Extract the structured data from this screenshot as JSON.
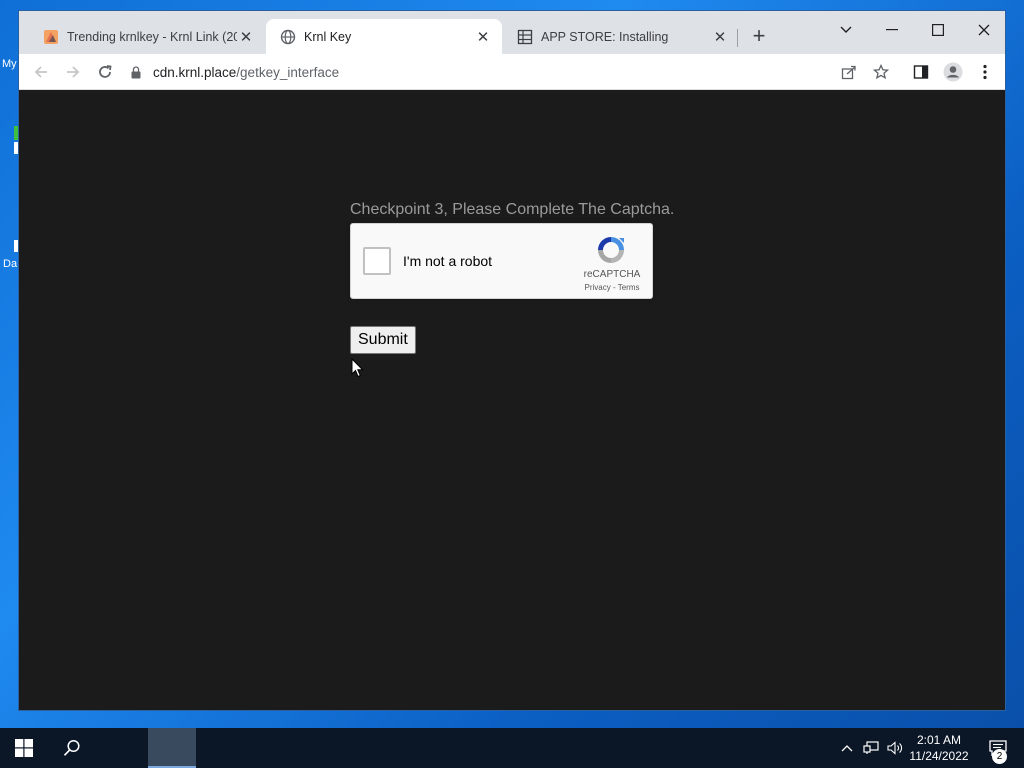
{
  "desktop": {
    "fragment_top": "My",
    "fragment_bottom": "Da"
  },
  "browser": {
    "tabs": [
      {
        "title": "Trending krnlkey - Krnl Link (202",
        "icon": "krnl-favicon",
        "active": false
      },
      {
        "title": "Krnl Key",
        "icon": "globe-icon",
        "active": true
      },
      {
        "title": "APP STORE: Installing",
        "icon": "table-icon",
        "active": false
      }
    ],
    "close_glyph": "✕",
    "new_tab_glyph": "+",
    "url_host": "cdn.krnl.place",
    "url_path": "/getkey_interface"
  },
  "page": {
    "title": "Checkpoint 3, Please Complete The Captcha.",
    "recaptcha": {
      "label": "I'm not a robot",
      "brand": "reCAPTCHA",
      "links": "Privacy - Terms"
    },
    "submit_label": "Submit"
  },
  "taskbar": {
    "time": "2:01 AM",
    "date": "11/24/2022",
    "notification_count": "2"
  },
  "colors": {
    "page_background": "#1b1b1c",
    "title_text": "#9a9a9a",
    "taskbar": "#0b1627",
    "desktop": "#1f8af0"
  }
}
